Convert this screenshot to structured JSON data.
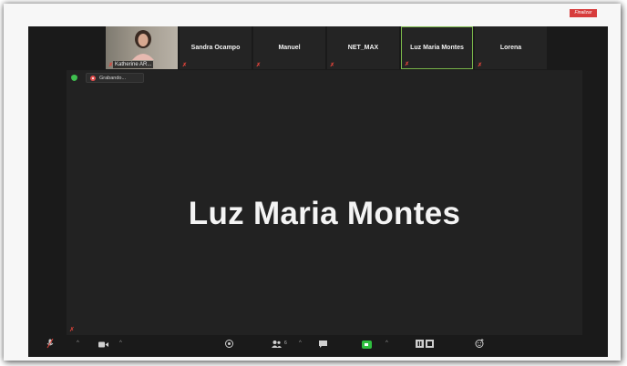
{
  "participants": [
    {
      "name": "Katherine AR..."
    },
    {
      "name": "Sandra Ocampo"
    },
    {
      "name": "Manuel"
    },
    {
      "name": "NET_MAX"
    },
    {
      "name": "Luz Maria Montes"
    },
    {
      "name": "Lorena"
    }
  ],
  "recording": {
    "label": "Grabando..."
  },
  "active_speaker": "Luz Maria Montes",
  "toolbar": {
    "participants_count": "6",
    "end_label": "Finalizar"
  },
  "colors": {
    "recording": "#e24d4d",
    "active_border": "#7bb84a",
    "muted_mic": "#e0443a",
    "share_green": "#2fbf3f",
    "end_red": "#d73c3c"
  }
}
